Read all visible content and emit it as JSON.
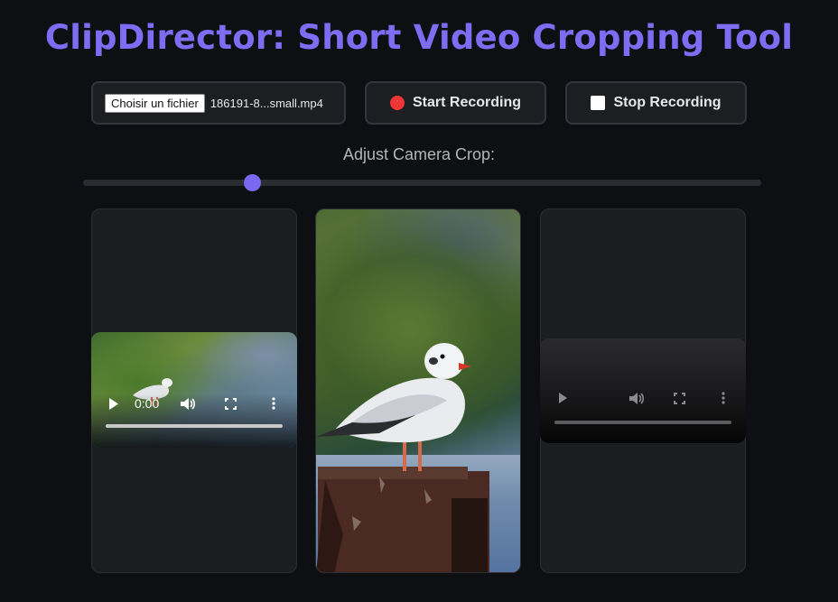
{
  "header": {
    "title": "ClipDirector: Short Video Cropping Tool"
  },
  "toolbar": {
    "file_button_label": "Choisir un fichier",
    "file_name": "186191-8...small.mp4",
    "start_label": "Start Recording",
    "stop_label": "Stop Recording"
  },
  "crop": {
    "label": "Adjust Camera Crop:",
    "value_fraction": 0.25
  },
  "left_player": {
    "time": "0:00",
    "progress_fraction": 0.0
  },
  "right_player": {
    "progress_fraction": 0.0
  },
  "colors": {
    "accent": "#7f6cf3",
    "record": "#ef3737",
    "panel": "#1c1d21"
  },
  "icons": [
    "record-dot-icon",
    "stop-square-icon",
    "play-icon",
    "volume-icon",
    "fullscreen-icon",
    "more-options-icon"
  ]
}
